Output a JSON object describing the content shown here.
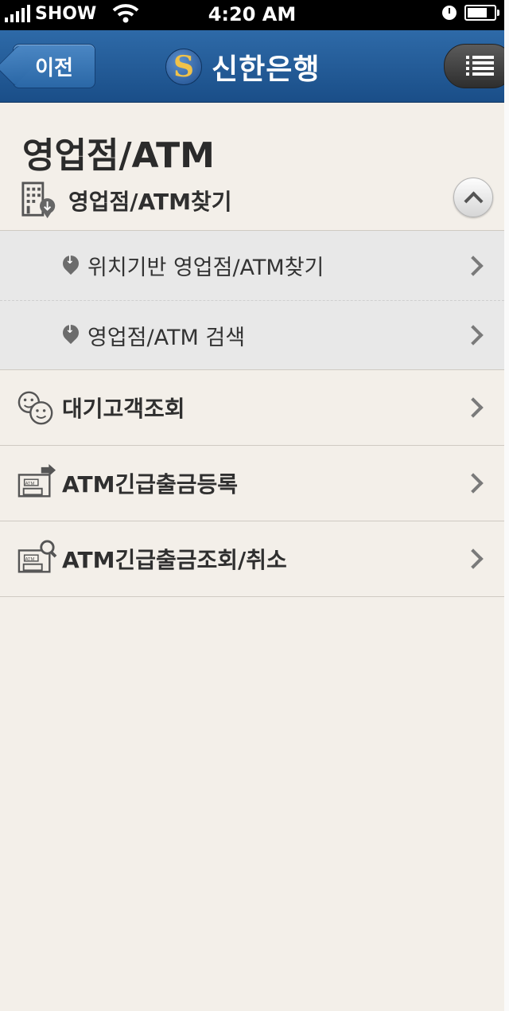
{
  "status_bar": {
    "carrier": "SHOW",
    "time": "4:20 AM"
  },
  "nav": {
    "back_label": "이전",
    "brand_title": "신한은행"
  },
  "page": {
    "title": "영업점/ATM"
  },
  "group": {
    "label": "영업점/ATM찾기",
    "items": [
      {
        "label": "위치기반 영업점/ATM찾기"
      },
      {
        "label": "영업점/ATM 검색"
      }
    ]
  },
  "menu": [
    {
      "label": "대기고객조회",
      "icon": "faces-icon"
    },
    {
      "label": "ATM긴급출금등록",
      "icon": "atm-arrow-icon"
    },
    {
      "label": "ATM긴급출금조회/취소",
      "icon": "atm-search-icon"
    }
  ],
  "colors": {
    "nav_bg": "#1a4e88",
    "page_bg": "#f3efe9",
    "sub_bg": "#e8e8e8"
  }
}
